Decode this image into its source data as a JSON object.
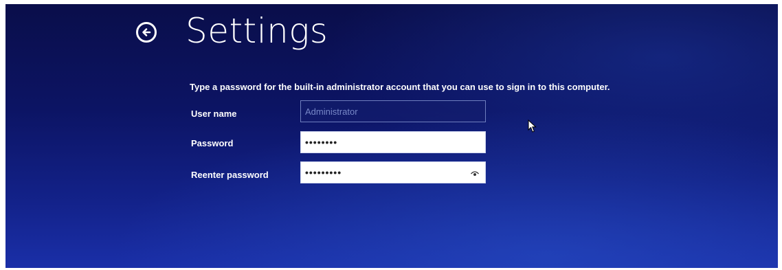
{
  "page": {
    "title": "Settings",
    "instruction": "Type a password for the built-in administrator account that you can use to sign in to this computer."
  },
  "form": {
    "username": {
      "label": "User name",
      "placeholder": "Administrator",
      "value": ""
    },
    "password": {
      "label": "Password",
      "value": "••••••••"
    },
    "reenter": {
      "label": "Reenter password",
      "value": "•••••••••"
    }
  },
  "icons": {
    "back": "back-arrow-icon",
    "reveal": "reveal-password-icon",
    "cursor": "mouse-pointer-icon"
  }
}
